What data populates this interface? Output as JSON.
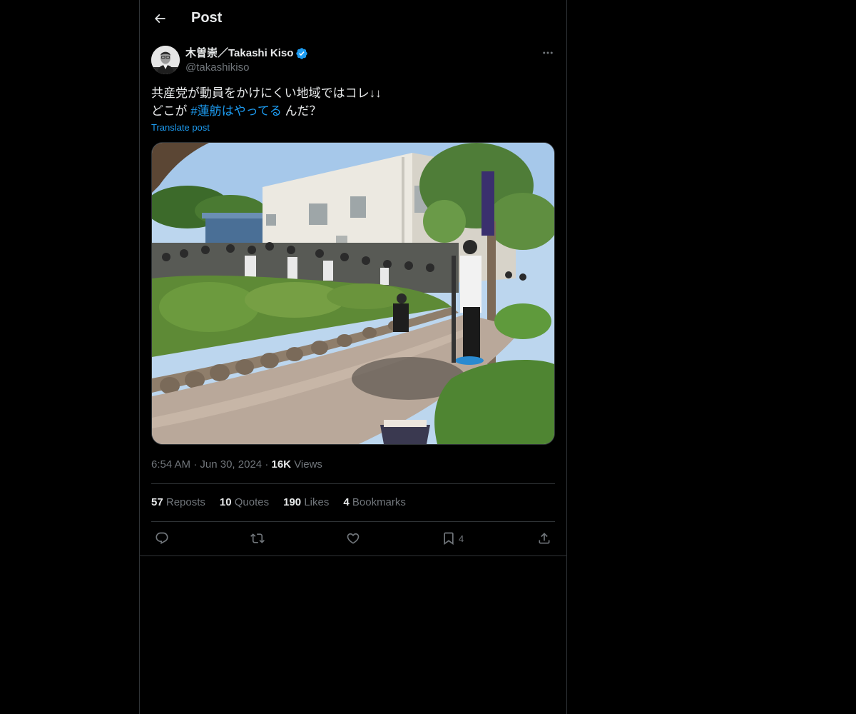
{
  "header": {
    "title": "Post"
  },
  "post": {
    "author": {
      "display_name": "木曽崇／Takashi Kiso",
      "handle": "@takashikiso",
      "verified": true
    },
    "text_line1": "共産党が動員をかけにくい地域ではコレ↓↓",
    "text_line2_before": "どこが ",
    "hashtag": "#蓮舫はやってる",
    "text_line2_after": " んだ？",
    "translate_label": "Translate post",
    "time": "6:54 AM",
    "date": "Jun 30, 2024",
    "views_count": "16K",
    "views_label": "Views",
    "stats": {
      "reposts_count": "57",
      "reposts_label": "Reposts",
      "quotes_count": "10",
      "quotes_label": "Quotes",
      "likes_count": "190",
      "likes_label": "Likes",
      "bookmarks_count": "4",
      "bookmarks_label": "Bookmarks"
    },
    "actions": {
      "bookmark_count": "4"
    }
  },
  "colors": {
    "background": "#000000",
    "text_primary": "#e7e9ea",
    "text_secondary": "#71767b",
    "accent": "#1d9bf0",
    "border": "#2f3336"
  }
}
